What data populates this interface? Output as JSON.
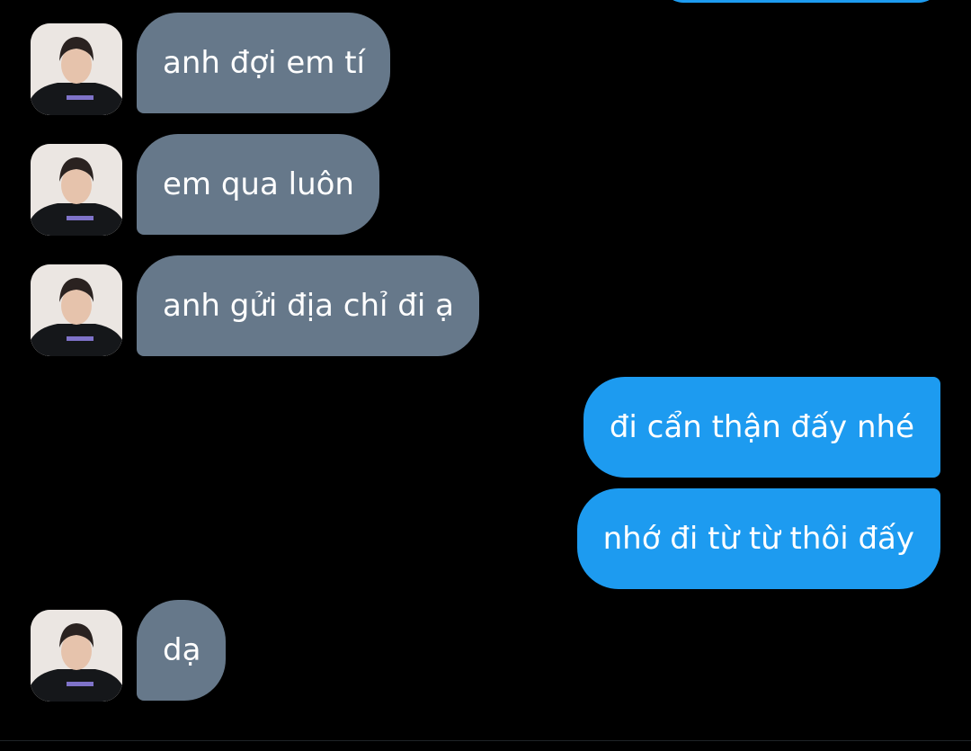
{
  "conversation": {
    "messages": [
      {
        "direction": "received",
        "text": "anh đợi em tí"
      },
      {
        "direction": "received",
        "text": "em qua luôn"
      },
      {
        "direction": "received",
        "text": "anh gửi địa chỉ đi ạ"
      },
      {
        "direction": "sent",
        "text": "đi cẩn thận đấy nhé"
      },
      {
        "direction": "sent",
        "text": "nhớ đi từ từ thôi đấy"
      },
      {
        "direction": "received",
        "text": "dạ"
      }
    ]
  },
  "colors": {
    "background": "#000000",
    "received_bubble": "#66788a",
    "sent_bubble": "#1d9bf0",
    "text": "#ffffff"
  },
  "icons": {
    "avatar": "contact-avatar"
  }
}
